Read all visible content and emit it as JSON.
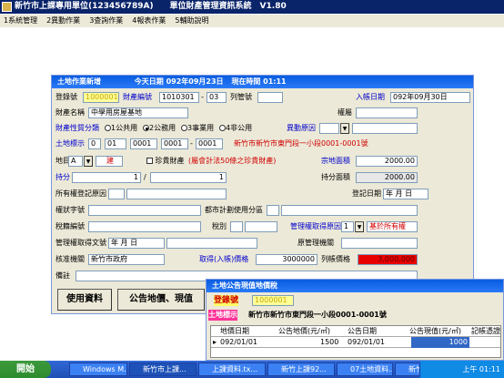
{
  "app": {
    "title": "新竹市上課專用單位(123456789A)　　單位財產管理資訊系統　V1.80",
    "menu": [
      "1系統管理",
      "2異動作業",
      "3查詢作業",
      "4報表作業",
      "5輔助說明"
    ]
  },
  "form": {
    "title": "土地作業新增",
    "today_label": "今天日期",
    "today": "092年09月23日",
    "now_label": "現在時間",
    "now": "01:11",
    "reg_no_label": "登錄號",
    "reg_no": "1000001",
    "asset_no_label": "財產編號",
    "asset_no": "1010301",
    "asset_no_suffix": "03",
    "list_no_label": "列管號",
    "entry_date_label": "入帳日期",
    "entry_date": "092年09月30日",
    "asset_name_label": "財產名稱",
    "asset_name": "中學用房屋基地",
    "rights_label": "權屬",
    "nature_label": "財產性質分類",
    "nature_options": [
      "1公共用",
      "2公務用",
      "3事業用",
      "4非公用"
    ],
    "nature_selected": 1,
    "change_reason_label": "異動原因",
    "land_mark_label": "土地標示",
    "land_mark": [
      "0",
      "01",
      "0001",
      "0001",
      "0001"
    ],
    "land_address": "新竹市新竹市東門段一小段0001-0001號",
    "land_cat_label": "地目",
    "land_cat": "A",
    "land_cat_name": "建",
    "treasure_label": "珍貴財產",
    "treasure_note": "(屬會計法50條之珍貴財產)",
    "area_label": "宗地面積",
    "area": "2000.00",
    "share_label": "持分",
    "share_num": "1",
    "share_den": "1",
    "share_area_label": "持分面積",
    "share_area": "2000.00",
    "reg_reason_label": "所有權登記原因",
    "reg_date_label": "登記日期",
    "reg_date": "年 月 日",
    "cert_label": "權狀字號",
    "zoning_label": "都市計劃使用分區",
    "tax_no_label": "稅籍編號",
    "tax_cat_label": "稅別",
    "mgmt_reason_label": "管理權取得原因",
    "mgmt_reason_code": "1",
    "mgmt_reason_name": "基於所有權",
    "mgmt_doc_label": "管理權取得文號",
    "mgmt_date": "年 月 日",
    "orig_mgr_label": "原管理機關",
    "approve_label": "核准機關",
    "approve": "新竹市政府",
    "price_label": "取得(入帳)價格",
    "price": "3000000",
    "list_price_label": "列帳價格",
    "list_price": "3,000,000",
    "note_label": "備註",
    "btn_use_data": "使用資料",
    "btn_public_price": "公告地價、現值"
  },
  "popup": {
    "title": "土地公告現值地價稅",
    "reg_label": "登錄號",
    "reg_no": "1000001",
    "land_label": "土地標示",
    "land_address": "新竹市新竹市東門段一小段0001-0001號",
    "columns": [
      "地價日期",
      "公告地價(元/㎡)",
      "公告日期",
      "公告現值(元/㎡)",
      "記帳憑證"
    ],
    "rows": [
      [
        "092/01/01",
        "1500",
        "092/01/01",
        "1000",
        ""
      ]
    ]
  },
  "taskbar": {
    "start": "開始",
    "tasks": [
      "Windows M...",
      "新竹市上課...",
      "上課資料.tx...",
      "新竹上課92...",
      "07土地資料...",
      "新竹市上課..."
    ],
    "time": "上午 01:11"
  }
}
